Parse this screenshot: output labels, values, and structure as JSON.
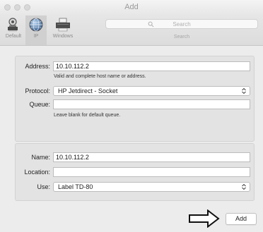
{
  "window": {
    "title": "Add"
  },
  "toolbar": {
    "items": [
      {
        "label": "Default",
        "icon": "default-printer-icon"
      },
      {
        "label": "IP",
        "icon": "ip-globe-icon",
        "selected": true
      },
      {
        "label": "Windows",
        "icon": "windows-printer-icon"
      }
    ],
    "search": {
      "placeholder": "Search",
      "label": "Search"
    }
  },
  "ip_form": {
    "address": {
      "label": "Address:",
      "value": "10.10.112.2",
      "hint": "Valid and complete host name or address."
    },
    "protocol": {
      "label": "Protocol:",
      "value": "HP Jetdirect - Socket"
    },
    "queue": {
      "label": "Queue:",
      "value": "",
      "hint": "Leave blank for default queue."
    }
  },
  "printer_form": {
    "name": {
      "label": "Name:",
      "value": "10.10.112.2"
    },
    "location": {
      "label": "Location:",
      "value": ""
    },
    "use": {
      "label": "Use:",
      "value": "Label TD-80"
    }
  },
  "footer": {
    "add_label": "Add"
  },
  "colors": {
    "window_bg": "#ececec",
    "panel_bg": "#e3e3e3",
    "toolbar_bg": "#e0e0e0"
  }
}
